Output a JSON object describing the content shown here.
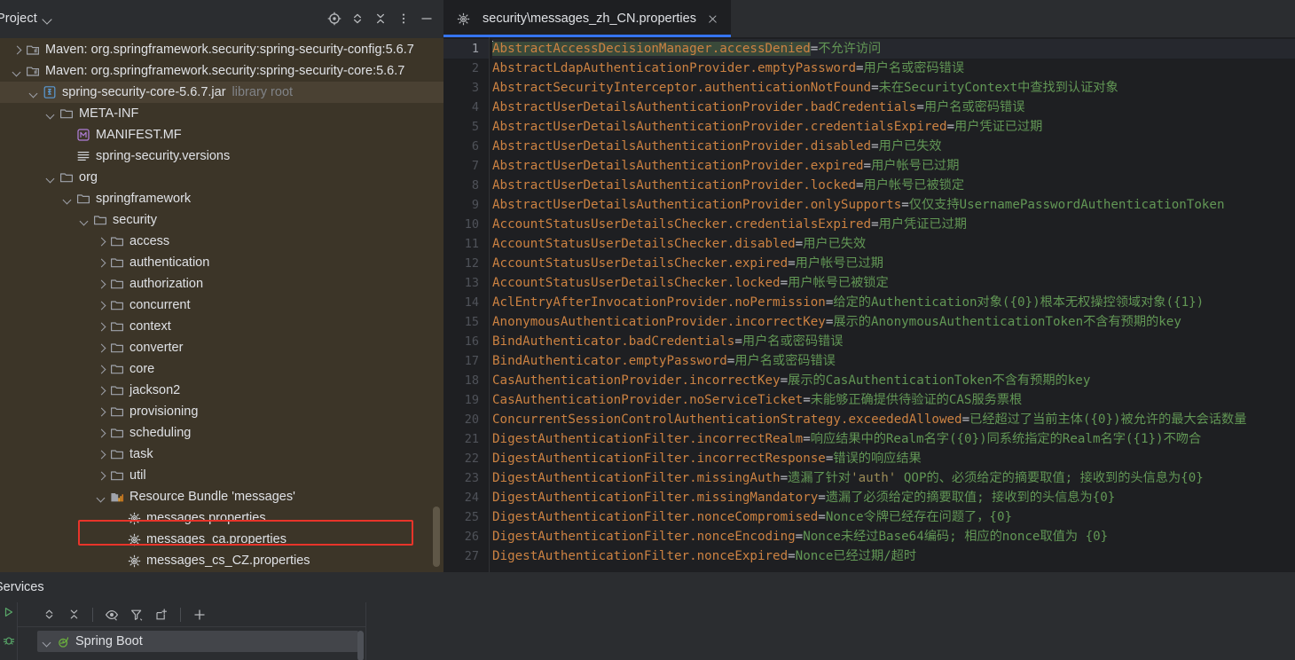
{
  "project_panel": {
    "title": "Project",
    "title_chevron_icon": "chevron-down-icon",
    "toolbar": [
      {
        "name": "locate-icon",
        "tip": "Select Opened File"
      },
      {
        "name": "expand-all-icon",
        "tip": "Expand All"
      },
      {
        "name": "collapse-all-icon",
        "tip": "Collapse All"
      },
      {
        "name": "more-options-icon",
        "tip": "Options"
      },
      {
        "name": "minimize-icon",
        "tip": "Hide"
      }
    ],
    "tree": [
      {
        "label": "Maven: org.springframework.security:spring-security-config:5.6.7",
        "sub": "",
        "indent": 0,
        "twisty": "right",
        "icon": "maven-library-icon",
        "selected": false
      },
      {
        "label": "Maven: org.springframework.security:spring-security-core:5.6.7",
        "sub": "",
        "indent": 0,
        "twisty": "down",
        "icon": "maven-library-icon",
        "selected": false
      },
      {
        "label": "spring-security-core-5.6.7.jar",
        "sub": "library root",
        "indent": 1,
        "twisty": "down",
        "icon": "jar-icon",
        "selected": true
      },
      {
        "label": "META-INF",
        "sub": "",
        "indent": 2,
        "twisty": "down",
        "icon": "folder-icon",
        "selected": false
      },
      {
        "label": "MANIFEST.MF",
        "sub": "",
        "indent": 3,
        "twisty": "none",
        "icon": "manifest-icon",
        "selected": false
      },
      {
        "label": "spring-security.versions",
        "sub": "",
        "indent": 3,
        "twisty": "none",
        "icon": "text-file-icon",
        "selected": false
      },
      {
        "label": "org",
        "sub": "",
        "indent": 2,
        "twisty": "down",
        "icon": "folder-icon",
        "selected": false
      },
      {
        "label": "springframework",
        "sub": "",
        "indent": 3,
        "twisty": "down",
        "icon": "folder-icon",
        "selected": false
      },
      {
        "label": "security",
        "sub": "",
        "indent": 4,
        "twisty": "down",
        "icon": "folder-icon",
        "selected": false
      },
      {
        "label": "access",
        "sub": "",
        "indent": 5,
        "twisty": "right",
        "icon": "folder-icon",
        "selected": false
      },
      {
        "label": "authentication",
        "sub": "",
        "indent": 5,
        "twisty": "right",
        "icon": "folder-icon",
        "selected": false
      },
      {
        "label": "authorization",
        "sub": "",
        "indent": 5,
        "twisty": "right",
        "icon": "folder-icon",
        "selected": false
      },
      {
        "label": "concurrent",
        "sub": "",
        "indent": 5,
        "twisty": "right",
        "icon": "folder-icon",
        "selected": false
      },
      {
        "label": "context",
        "sub": "",
        "indent": 5,
        "twisty": "right",
        "icon": "folder-icon",
        "selected": false
      },
      {
        "label": "converter",
        "sub": "",
        "indent": 5,
        "twisty": "right",
        "icon": "folder-icon",
        "selected": false
      },
      {
        "label": "core",
        "sub": "",
        "indent": 5,
        "twisty": "right",
        "icon": "folder-icon",
        "selected": false
      },
      {
        "label": "jackson2",
        "sub": "",
        "indent": 5,
        "twisty": "right",
        "icon": "folder-icon",
        "selected": false
      },
      {
        "label": "provisioning",
        "sub": "",
        "indent": 5,
        "twisty": "right",
        "icon": "folder-icon",
        "selected": false
      },
      {
        "label": "scheduling",
        "sub": "",
        "indent": 5,
        "twisty": "right",
        "icon": "folder-icon",
        "selected": false
      },
      {
        "label": "task",
        "sub": "",
        "indent": 5,
        "twisty": "right",
        "icon": "folder-icon",
        "selected": false
      },
      {
        "label": "util",
        "sub": "",
        "indent": 5,
        "twisty": "right",
        "icon": "folder-icon",
        "selected": false
      },
      {
        "label": "Resource Bundle 'messages'",
        "sub": "",
        "indent": 5,
        "twisty": "down",
        "icon": "resource-bundle-icon",
        "selected": false
      },
      {
        "label": "messages.properties",
        "sub": "",
        "indent": 6,
        "twisty": "none",
        "icon": "properties-file-icon",
        "selected": false
      },
      {
        "label": "messages_ca.properties",
        "sub": "",
        "indent": 6,
        "twisty": "none",
        "icon": "properties-file-icon",
        "selected": false
      },
      {
        "label": "messages_cs_CZ.properties",
        "sub": "",
        "indent": 6,
        "twisty": "none",
        "icon": "properties-file-icon",
        "selected": false
      }
    ],
    "annotation": {
      "type": "red-highlight-box",
      "targets_row_label": "Resource Bundle 'messages'",
      "color": "#e8342a"
    }
  },
  "editor": {
    "tab": {
      "icon": "properties-file-icon",
      "label": "security\\messages_zh_CN.properties",
      "close_icon": "close-icon",
      "active_underline_color": "#3574f0"
    },
    "current_line": 1,
    "lines": [
      {
        "n": 1,
        "key": "AbstractAccessDecisionManager.accessDenied",
        "value": "不允许访问"
      },
      {
        "n": 2,
        "key": "AbstractLdapAuthenticationProvider.emptyPassword",
        "value": "用户名或密码错误"
      },
      {
        "n": 3,
        "key": "AbstractSecurityInterceptor.authenticationNotFound",
        "value": "未在SecurityContext中查找到认证对象"
      },
      {
        "n": 4,
        "key": "AbstractUserDetailsAuthenticationProvider.badCredentials",
        "value": "用户名或密码错误"
      },
      {
        "n": 5,
        "key": "AbstractUserDetailsAuthenticationProvider.credentialsExpired",
        "value": "用户凭证已过期"
      },
      {
        "n": 6,
        "key": "AbstractUserDetailsAuthenticationProvider.disabled",
        "value": "用户已失效"
      },
      {
        "n": 7,
        "key": "AbstractUserDetailsAuthenticationProvider.expired",
        "value": "用户帐号已过期"
      },
      {
        "n": 8,
        "key": "AbstractUserDetailsAuthenticationProvider.locked",
        "value": "用户帐号已被锁定"
      },
      {
        "n": 9,
        "key": "AbstractUserDetailsAuthenticationProvider.onlySupports",
        "value": "仅仅支持UsernamePasswordAuthenticationToken"
      },
      {
        "n": 10,
        "key": "AccountStatusUserDetailsChecker.credentialsExpired",
        "value": "用户凭证已过期"
      },
      {
        "n": 11,
        "key": "AccountStatusUserDetailsChecker.disabled",
        "value": "用户已失效"
      },
      {
        "n": 12,
        "key": "AccountStatusUserDetailsChecker.expired",
        "value": "用户帐号已过期"
      },
      {
        "n": 13,
        "key": "AccountStatusUserDetailsChecker.locked",
        "value": "用户帐号已被锁定"
      },
      {
        "n": 14,
        "key": "AclEntryAfterInvocationProvider.noPermission",
        "value": "给定的Authentication对象({0})根本无权操控领域对象({1})"
      },
      {
        "n": 15,
        "key": "AnonymousAuthenticationProvider.incorrectKey",
        "value": "展示的AnonymousAuthenticationToken不含有预期的key"
      },
      {
        "n": 16,
        "key": "BindAuthenticator.badCredentials",
        "value": "用户名或密码错误"
      },
      {
        "n": 17,
        "key": "BindAuthenticator.emptyPassword",
        "value": "用户名或密码错误"
      },
      {
        "n": 18,
        "key": "CasAuthenticationProvider.incorrectKey",
        "value": "展示的CasAuthenticationToken不含有预期的key"
      },
      {
        "n": 19,
        "key": "CasAuthenticationProvider.noServiceTicket",
        "value": "未能够正确提供待验证的CAS服务票根"
      },
      {
        "n": 20,
        "key": "ConcurrentSessionControlAuthenticationStrategy.exceededAllowed",
        "value": "已经超过了当前主体({0})被允许的最大会话数量"
      },
      {
        "n": 21,
        "key": "DigestAuthenticationFilter.incorrectRealm",
        "value": "响应结果中的Realm名字({0})同系统指定的Realm名字({1})不吻合"
      },
      {
        "n": 22,
        "key": "DigestAuthenticationFilter.incorrectResponse",
        "value": "错误的响应结果"
      },
      {
        "n": 23,
        "key": "DigestAuthenticationFilter.missingAuth",
        "value": "遗漏了针对'auth' QOP的、必须给定的摘要取值; 接收到的头信息为{0}",
        "quoted": "'auth'"
      },
      {
        "n": 24,
        "key": "DigestAuthenticationFilter.missingMandatory",
        "value": "遗漏了必须给定的摘要取值; 接收到的头信息为{0}"
      },
      {
        "n": 25,
        "key": "DigestAuthenticationFilter.nonceCompromised",
        "value": "Nonce令牌已经存在问题了，{0}"
      },
      {
        "n": 26,
        "key": "DigestAuthenticationFilter.nonceEncoding",
        "value": "Nonce未经过Base64编码; 相应的nonce取值为 {0}"
      },
      {
        "n": 27,
        "key": "DigestAuthenticationFilter.nonceExpired",
        "value": "Nonce已经过期/超时"
      }
    ],
    "colors": {
      "key": "#cc8242",
      "equals": "#bcbec4",
      "value": "#629755",
      "quoted": "#9a8a56",
      "selection": "#3a4a3a"
    }
  },
  "services": {
    "title": "Services",
    "stripe_icons": [
      {
        "name": "run-icon"
      },
      {
        "name": "debug-icon"
      }
    ],
    "toolbar": [
      {
        "name": "expand-all-icon"
      },
      {
        "name": "collapse-all-icon"
      },
      {
        "name": "separator"
      },
      {
        "name": "eye-show-icon"
      },
      {
        "name": "filter-icon"
      },
      {
        "name": "group-icon"
      },
      {
        "name": "separator"
      },
      {
        "name": "add-icon"
      }
    ],
    "items": [
      {
        "label": "Spring Boot",
        "icon": "spring-boot-icon",
        "twisty": "down",
        "selected": true
      }
    ]
  }
}
